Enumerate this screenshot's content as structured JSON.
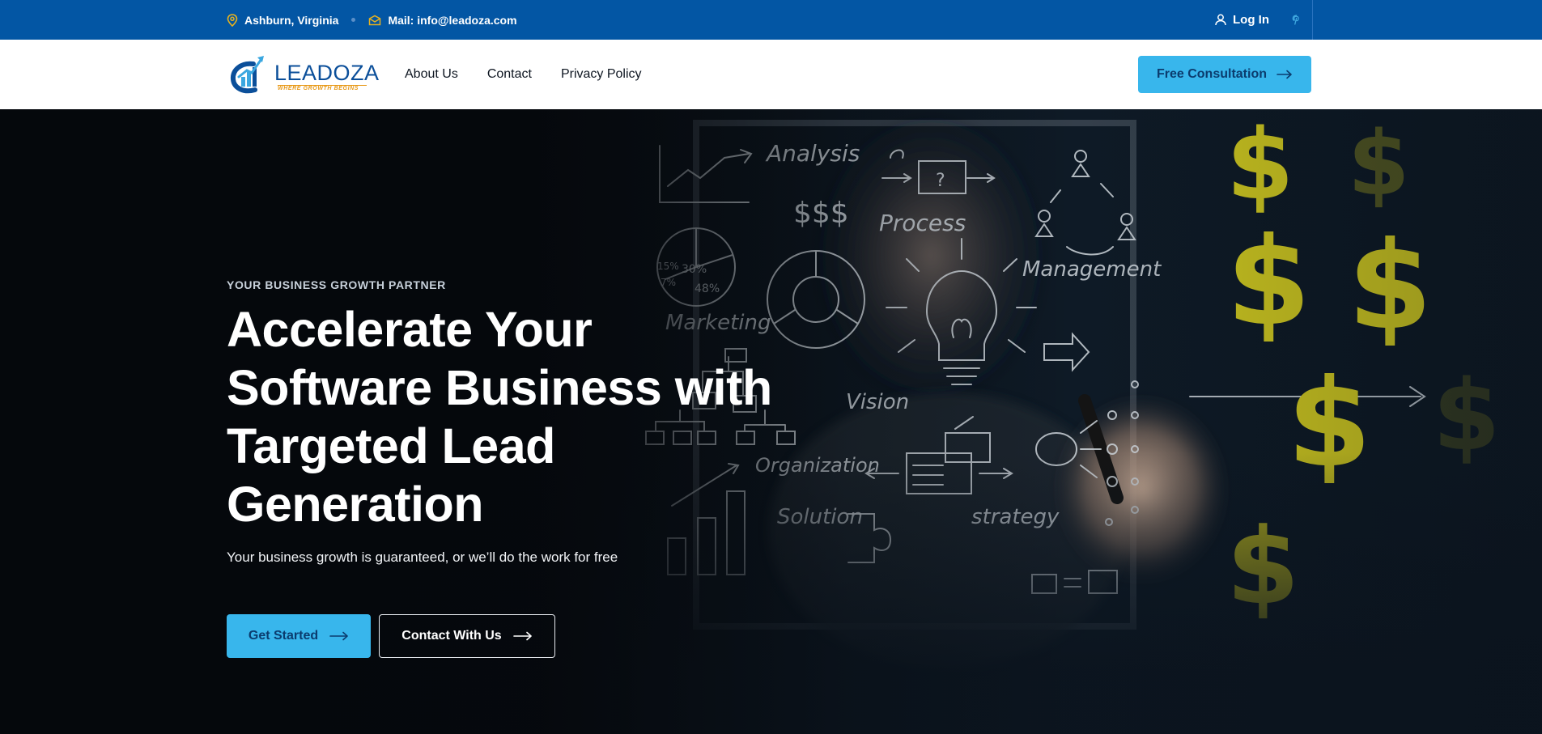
{
  "topbar": {
    "location": "Ashburn, Virginia",
    "mail": "Mail: info@leadoza.com",
    "login": "Log In"
  },
  "header": {
    "logo_text": "LEADOZA",
    "logo_tagline": "WHERE GROWTH BEGINS",
    "nav": [
      "About Us",
      "Contact",
      "Privacy Policy"
    ],
    "cta": "Free Consultation"
  },
  "hero": {
    "eyebrow": "YOUR BUSINESS GROWTH PARTNER",
    "headline": "Accelerate Your Software Business with Targeted Lead Generation",
    "subline": "Your business growth is guaranteed, or we’ll do the work for free",
    "primary_button": "Get Started",
    "secondary_button": "Contact With Us",
    "board_words": {
      "analysis": "Analysis",
      "dollars": "$$$",
      "process": "Process",
      "marketing": "Marketing",
      "management": "Management",
      "vision": "Vision",
      "organization": "Organization",
      "solution": "Solution",
      "strategy": "strategy",
      "pie_30": "30%",
      "pie_15": "15%",
      "pie_7": "7%",
      "pie_48": "48%",
      "question": "?"
    }
  },
  "colors": {
    "topbar_bg": "#0356a4",
    "accent": "#38b6ec",
    "accent_text": "#0b3c6e",
    "hero_bg": "#05080c",
    "dollar_yellow": "#c9c21e"
  },
  "icons": {
    "location": "map-pin-icon",
    "mail": "envelope-icon",
    "login": "user-icon",
    "social": "pinterest-icon",
    "arrow": "arrow-right-icon"
  }
}
